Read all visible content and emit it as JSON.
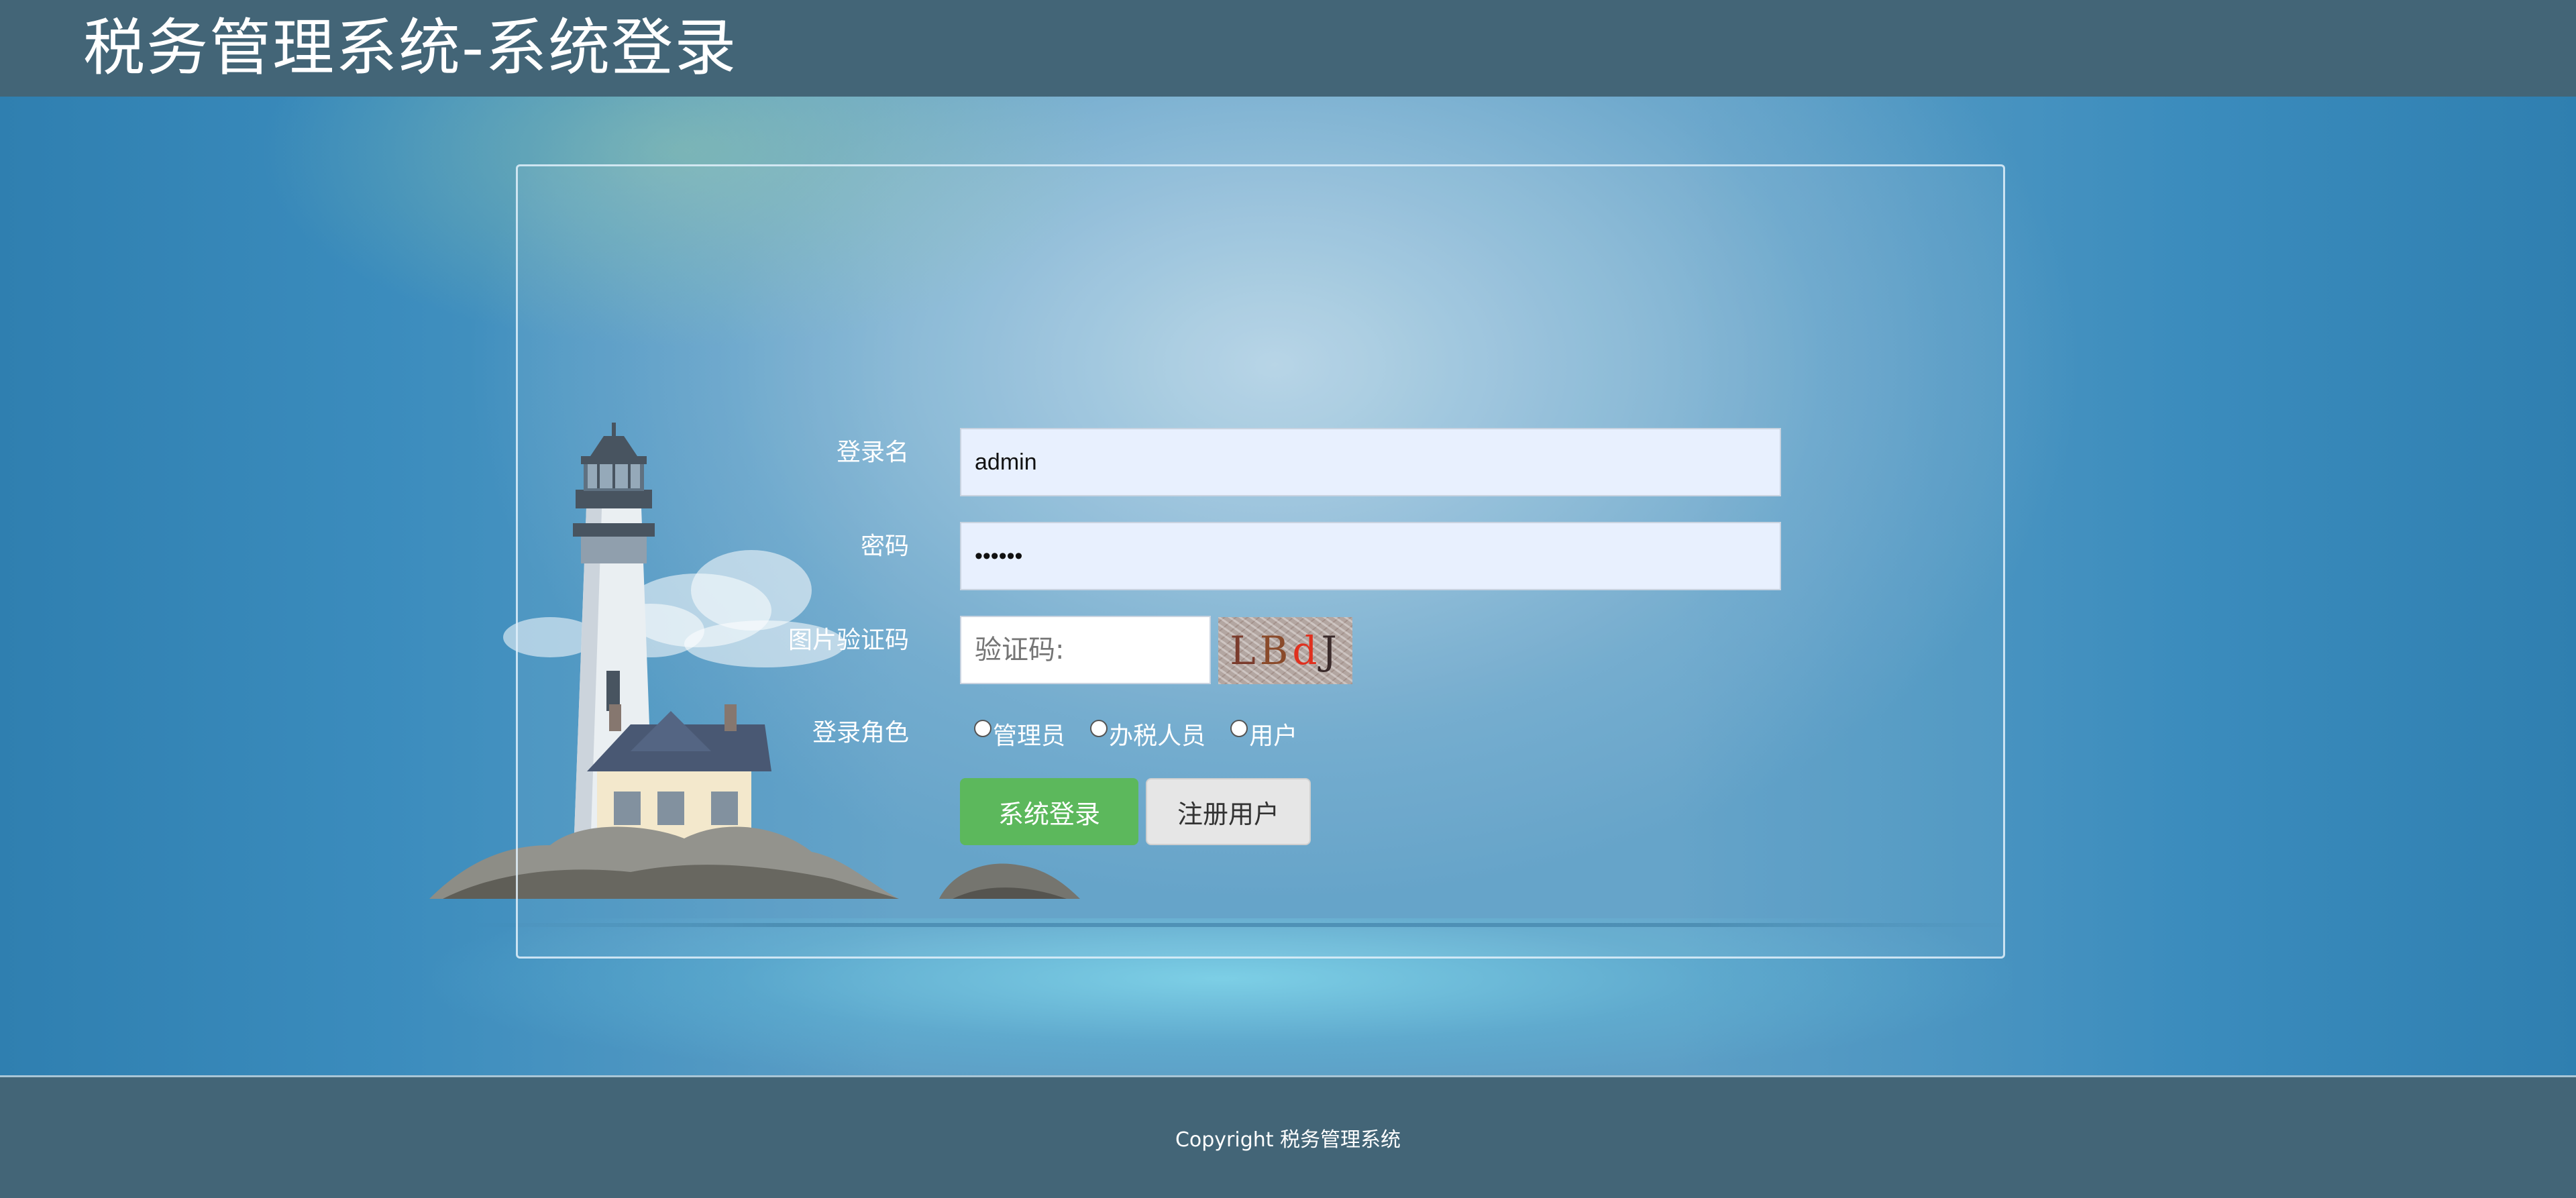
{
  "header": {
    "title": "税务管理系统-系统登录"
  },
  "login": {
    "username": {
      "label": "登录名",
      "value": "admin"
    },
    "password": {
      "label": "密码",
      "value": "123456"
    },
    "captcha": {
      "label": "图片验证码",
      "placeholder": "验证码:",
      "image_chars": [
        "L",
        "B",
        "d",
        "J"
      ],
      "image_char_colors": [
        "#7a3b2c",
        "#8a4a2a",
        "#e0301e",
        "#3a2a2a"
      ]
    },
    "role": {
      "label": "登录角色",
      "options": [
        "管理员",
        "办税人员",
        "用户"
      ],
      "selected": null
    },
    "buttons": {
      "login": "系统登录",
      "register": "注册用户"
    }
  },
  "footer": {
    "copyright": "Copyright 税务管理系统"
  },
  "colors": {
    "header_bg": "#436577",
    "login_button": "#5cb85c",
    "register_button": "#e6e6e6",
    "input_autofill_bg": "#e8f0fe",
    "page_bg": "#3a89b8"
  },
  "icons": {
    "illustration": "lighthouse-island"
  }
}
